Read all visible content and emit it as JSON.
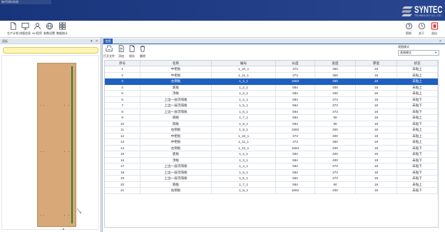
{
  "app": {
    "title": "新代排料系统"
  },
  "brand": {
    "name": "SYNTEC",
    "tagline": "TECHNOLOGY CO., LTD."
  },
  "toolbar": {
    "items": [
      {
        "label": "生产计划",
        "icon": "document-icon"
      },
      {
        "label": "排版信息",
        "icon": "monitor-icon"
      },
      {
        "label": "NC程序",
        "icon": "user-icon"
      },
      {
        "label": "参数设置",
        "icon": "globe-icon"
      },
      {
        "label": "数据统计",
        "icon": "grid-icon"
      }
    ],
    "right_items": [
      {
        "label": "帮助",
        "icon": "help-icon"
      },
      {
        "label": "关于",
        "icon": "clock-icon"
      },
      {
        "label": "退出",
        "icon": "exit-icon"
      }
    ]
  },
  "left_panel": {
    "title": "面板",
    "dropdown_glyph": "▾",
    "close_glyph": "×",
    "search": {
      "value": ""
    }
  },
  "right_panel": {
    "tab": "信息",
    "close_glyph": "×",
    "actions": [
      {
        "label": "打开文件",
        "icon": "open-tray-icon"
      },
      {
        "label": "添加",
        "icon": "new-document-icon"
      },
      {
        "label": "保存",
        "icon": "save-document-icon"
      },
      {
        "label": "删除",
        "icon": "trash-icon"
      }
    ],
    "view_mode": {
      "label": "视图模式",
      "value": "表格模式",
      "arrow": "▾"
    }
  },
  "table": {
    "columns": [
      "序号",
      "名称",
      "编号",
      "长度",
      "宽度",
      "厚度",
      "状态"
    ],
    "selected_row": 3,
    "rows": [
      [
        "1",
        "中柜板",
        "1_10_1",
        "373",
        "350",
        "18",
        "未贴上"
      ],
      [
        "2",
        "中柜板",
        "1_11_1",
        "373",
        "350",
        "18",
        "未贴上"
      ],
      [
        "3",
        "左侧板",
        "1_2_1",
        "1663",
        "350",
        "18",
        "未贴上"
      ],
      [
        "4",
        "底板",
        "1_2_1",
        "584",
        "400",
        "18",
        "未贴上"
      ],
      [
        "5",
        "顶板",
        "1_3_1",
        "584",
        "400",
        "18",
        "未贴上"
      ],
      [
        "6",
        "上边一层次隔板",
        "1_4_1",
        "584",
        "373",
        "18",
        "未贴下"
      ],
      [
        "7",
        "上边一层次隔板",
        "1_5_1",
        "584",
        "373",
        "18",
        "未贴下"
      ],
      [
        "8",
        "上边一层次隔板",
        "1_6_1",
        "584",
        "373",
        "18",
        "未贴下"
      ],
      [
        "9",
        "隔板",
        "1_7_1",
        "584",
        "80",
        "18",
        "未贴上"
      ],
      [
        "10",
        "隔板",
        "1_8_1",
        "584",
        "80",
        "18",
        "未贴下"
      ],
      [
        "11",
        "右侧板",
        "1_9_1",
        "1663",
        "400",
        "18",
        "未贴上"
      ],
      [
        "12",
        "中柜板",
        "1_10_1",
        "373",
        "300",
        "18",
        "未贴上"
      ],
      [
        "13",
        "中柜板",
        "1_11_1",
        "373",
        "350",
        "18",
        "未贴上"
      ],
      [
        "14",
        "左侧板",
        "1_12_1",
        "1663",
        "400",
        "18",
        "未贴下"
      ],
      [
        "15",
        "底板",
        "1_2_1",
        "584",
        "400",
        "18",
        "未贴下"
      ],
      [
        "16",
        "顶板",
        "1_3_1",
        "584",
        "400",
        "18",
        "未贴下"
      ],
      [
        "17",
        "上边一层次隔板",
        "1_4_1",
        "584",
        "373",
        "18",
        "未贴下"
      ],
      [
        "18",
        "上边一层次隔板",
        "1_5_1",
        "584",
        "373",
        "18",
        "未贴下"
      ],
      [
        "19",
        "上边一层次隔板",
        "1_5_1",
        "584",
        "373",
        "18",
        "未贴下"
      ],
      [
        "20",
        "隔板",
        "1_7_1",
        "584",
        "80",
        "18",
        "未贴上"
      ],
      [
        "21",
        "右侧板",
        "1_5_1",
        "1663",
        "400",
        "18",
        "未贴下"
      ]
    ]
  },
  "colors": {
    "header_bg": "#1b3a88",
    "accent": "#2e63b6",
    "selected_row_bg": "#1f5fc0",
    "board_fill": "#d8a878",
    "board_edge_line": "#2e7d32",
    "search_bg": "#fff6b4",
    "exit_red": "#d9302c"
  }
}
